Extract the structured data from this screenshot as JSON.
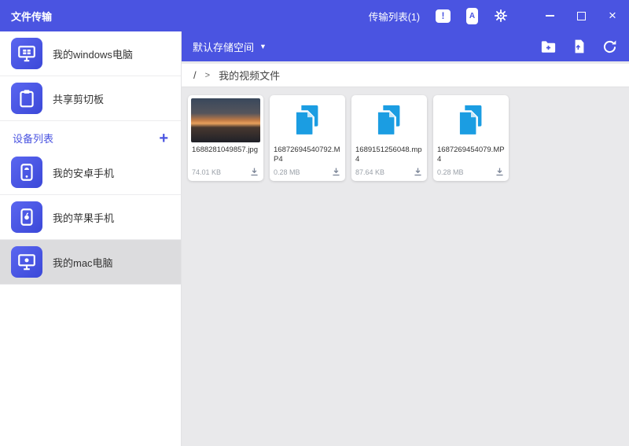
{
  "titlebar": {
    "title": "文件传输",
    "transfer_list_label": "传输列表(1)",
    "feedback_glyph": "!",
    "phone_glyph": "A",
    "close_glyph": "×"
  },
  "sidebar": {
    "computer_items": [
      {
        "label": "我的windows电脑",
        "icon": "windows-pc-icon"
      },
      {
        "label": "共享剪切板",
        "icon": "clipboard-icon"
      }
    ],
    "device_section_title": "设备列表",
    "add_device_glyph": "+",
    "devices": [
      {
        "label": "我的安卓手机",
        "icon": "android-phone-icon",
        "selected": false
      },
      {
        "label": "我的苹果手机",
        "icon": "apple-phone-icon",
        "selected": false
      },
      {
        "label": "我的mac电脑",
        "icon": "mac-computer-icon",
        "selected": true
      }
    ]
  },
  "toolbar": {
    "storage_label": "默认存储空间",
    "caret_glyph": "▼",
    "icon_names": [
      "new-folder-icon",
      "upload-file-icon",
      "refresh-icon"
    ]
  },
  "breadcrumb": {
    "root": "/",
    "separator": ">",
    "current": "我的视频文件"
  },
  "files": [
    {
      "name": "1688281049857.jpg",
      "size": "74.01 KB",
      "type": "image",
      "icon": "photo-thumbnail"
    },
    {
      "name": "16872694540792.MP4",
      "size": "0.28 MB",
      "type": "video",
      "icon": "file-copy-icon"
    },
    {
      "name": "1689151256048.mp4",
      "size": "87.64 KB",
      "type": "video",
      "icon": "file-copy-icon"
    },
    {
      "name": "1687269454079.MP4",
      "size": "0.28 MB",
      "type": "video",
      "icon": "file-copy-icon"
    }
  ],
  "colors": {
    "primary": "#4a54e1",
    "file_icon_blue": "#1b9de2",
    "content_bg": "#e9e9eb",
    "selected_row": "#dcdcde"
  }
}
